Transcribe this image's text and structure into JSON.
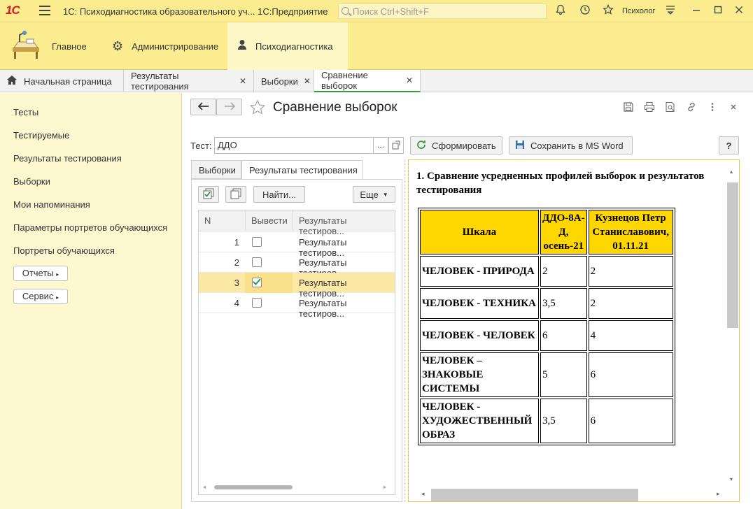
{
  "titlebar": {
    "logo": "1С",
    "title": "1С: Психодиагностика образовательного уч...  1С:Предприятие",
    "search_placeholder": "Поиск Ctrl+Shift+F",
    "user": "Психолог"
  },
  "sections": [
    "Главное",
    "Администрирование",
    "Психодиагностика"
  ],
  "tabs": [
    {
      "label": "Начальная страница"
    },
    {
      "label": "Результаты тестирования"
    },
    {
      "label": "Выборки"
    },
    {
      "label": "Сравнение выборок"
    }
  ],
  "sidebar": {
    "items": [
      "Тесты",
      "Тестируемые",
      "Результаты тестирования",
      "Выборки",
      "Мои напоминания",
      "Параметры портретов обучающихся",
      "Портреты обучающихся"
    ],
    "buttons": [
      "Отчеты",
      "Сервис"
    ]
  },
  "form": {
    "title": "Сравнение выборок",
    "test_label": "Тест:",
    "test_value": "ДДО",
    "test_dots": "...",
    "btn_generate": "Сформировать",
    "btn_save_word": "Сохранить в MS Word",
    "btn_help": "?",
    "inner_tabs": [
      "Выборки",
      "Результаты тестирования"
    ],
    "btn_find": "Найти...",
    "btn_more": "Еще",
    "columns": [
      "N",
      "Вывести",
      "Результаты тестиров..."
    ],
    "rows": [
      {
        "n": "1",
        "checked": false,
        "value": "Результаты тестиров..."
      },
      {
        "n": "2",
        "checked": false,
        "value": "Результаты тестиров..."
      },
      {
        "n": "3",
        "checked": true,
        "value": "Результаты тестиров..."
      },
      {
        "n": "4",
        "checked": false,
        "value": "Результаты тестиров..."
      }
    ]
  },
  "report": {
    "heading": "1. Сравнение усредненных профилей выборок и результатов тестирования",
    "header": [
      "Шкала",
      "ДДО-8А-Д, осень-21",
      "Кузнецов Петр Станиславович, 01.11.21"
    ],
    "rows": [
      [
        "ЧЕЛОВЕК - ПРИРОДА",
        "2",
        "2"
      ],
      [
        "ЧЕЛОВЕК - ТЕХНИКА",
        "3,5",
        "2"
      ],
      [
        "ЧЕЛОВЕК - ЧЕЛОВЕК",
        "6",
        "4"
      ],
      [
        "ЧЕЛОВЕК – ЗНАКОВЫЕ СИСТЕМЫ",
        "5",
        "6"
      ],
      [
        "ЧЕЛОВЕК - ХУДОЖЕСТВЕННЫЙ ОБРАЗ",
        "3,5",
        "6"
      ]
    ]
  },
  "colors": {
    "accent_yellow": "#fbec8f",
    "header_gold": "#ffd700",
    "selected_row": "#fce9a6",
    "active_tab_line": "#3a9a3a"
  }
}
